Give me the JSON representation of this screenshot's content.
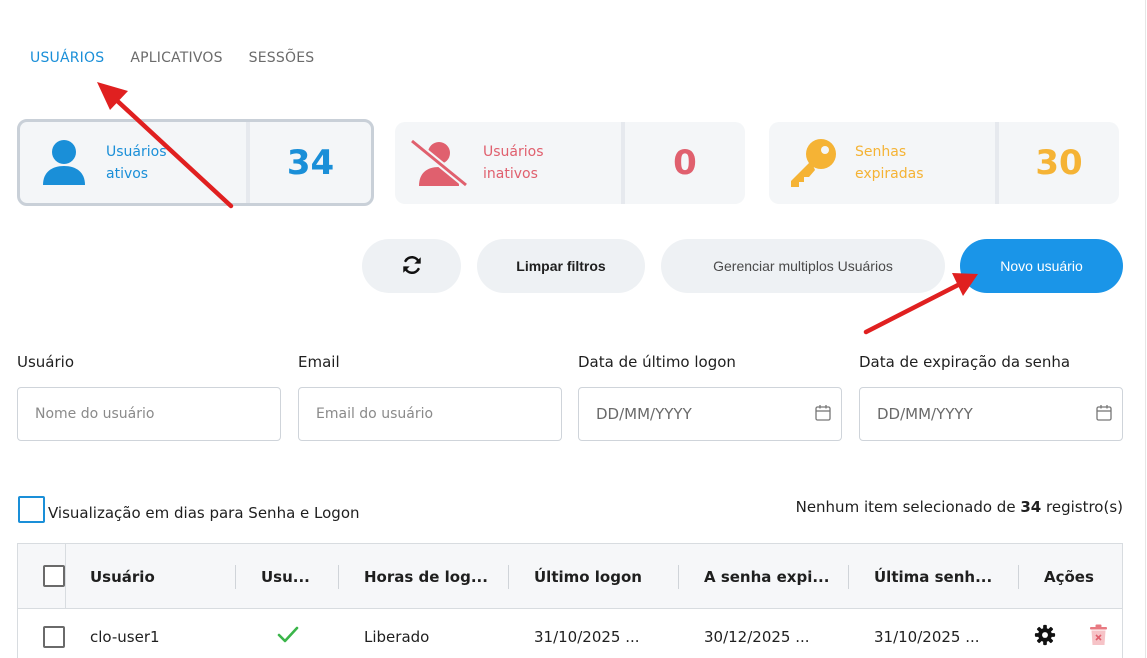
{
  "tabs": [
    {
      "label": "USUÁRIOS",
      "active": true
    },
    {
      "label": "APLICATIVOS",
      "active": false
    },
    {
      "label": "SESSÕES",
      "active": false
    }
  ],
  "stats": {
    "active": {
      "line1": "Usuários",
      "line2": "ativos",
      "count": "34",
      "color": "#1a8fd8",
      "icon": "user-icon"
    },
    "inactive": {
      "line1": "Usuários",
      "line2": "inativos",
      "count": "0",
      "color": "#e0606e",
      "icon": "user-slash-icon"
    },
    "expired": {
      "line1": "Senhas",
      "line2": "expiradas",
      "count": "30",
      "color": "#f5b335",
      "icon": "key-icon"
    }
  },
  "toolbar": {
    "refresh_icon": "refresh-icon",
    "clear_filters": "Limpar filtros",
    "manage_multiple": "Gerenciar multiplos Usuários",
    "new_user": "Novo usuário"
  },
  "filters": {
    "user": {
      "label": "Usuário",
      "placeholder": "Nome do usuário"
    },
    "email": {
      "label": "Email",
      "placeholder": "Email do usuário"
    },
    "last_logon": {
      "label": "Data de último logon",
      "placeholder": "DD/MM/YYYY"
    },
    "password_expiry": {
      "label": "Data de expiração da senha",
      "placeholder": "DD/MM/YYYY"
    }
  },
  "days_view_label": "Visualização em dias para Senha e Logon",
  "selection": {
    "prefix": "Nenhum item selecionado de",
    "count": "34",
    "suffix": "registro(s)"
  },
  "table": {
    "headers": [
      "Usuário",
      "Usu...",
      "Horas de log...",
      "Último logon",
      "A senha expi...",
      "Última senh...",
      "Ações"
    ],
    "rows": [
      {
        "user": "clo-user1",
        "status": "check-icon",
        "hours": "Liberado",
        "last_logon": "31/10/2025 ...",
        "password_expires": "30/12/2025 ...",
        "last_password": "31/10/2025 ..."
      }
    ]
  },
  "colors": {
    "accent": "#1a8fd8",
    "primary_button": "#1a95e8",
    "danger": "#e0606e",
    "warning": "#f5b335",
    "success": "#3bb54a",
    "annotation_arrow": "#e02020"
  }
}
